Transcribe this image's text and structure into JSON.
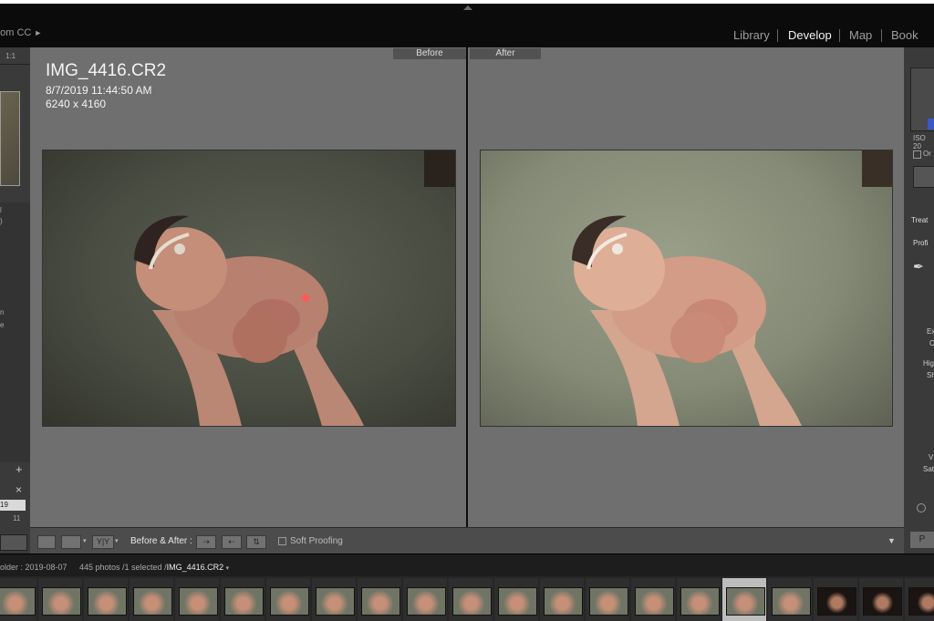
{
  "app_title": "oom CC",
  "modules": [
    {
      "label": "Library"
    },
    {
      "label": "Develop"
    },
    {
      "label": "Map"
    },
    {
      "label": "Book"
    }
  ],
  "before_label": "Before",
  "after_label": "After",
  "photo_info": {
    "filename": "IMG_4416.CR2",
    "datetime": "8/7/2019 11:44:50 AM",
    "dimensions": "6240 x 4160"
  },
  "left_panel": {
    "zoom": "1:1",
    "plus": "+",
    "close": "×",
    "item_a": "19",
    "item_b": "11"
  },
  "right_panel": {
    "iso": "ISO 20",
    "orig": "Or",
    "treatment": "Treat",
    "profile": "Profi",
    "exposure": "Ex",
    "contrast": "C",
    "highlights": "Hig",
    "shadows": "Sh",
    "vibrance": "V",
    "saturation": "Sat",
    "btn": "P"
  },
  "toolbar": {
    "yy_label": "Y|Y",
    "before_after_label": "Before & After :",
    "soft_proofing_label": "Soft Proofing"
  },
  "filmstrip": {
    "folder_text": "older : 2019-08-07",
    "count_text": "445 photos /1 selected /",
    "selected_file": "IMG_4416.CR2",
    "thumb_count": 21,
    "selected_index": 16
  },
  "colors": {
    "background_dark": "#0b0b0b",
    "panel": "#3a3a3a",
    "canvas": "#6f6f6f",
    "active_module": "#f2f2f2"
  }
}
